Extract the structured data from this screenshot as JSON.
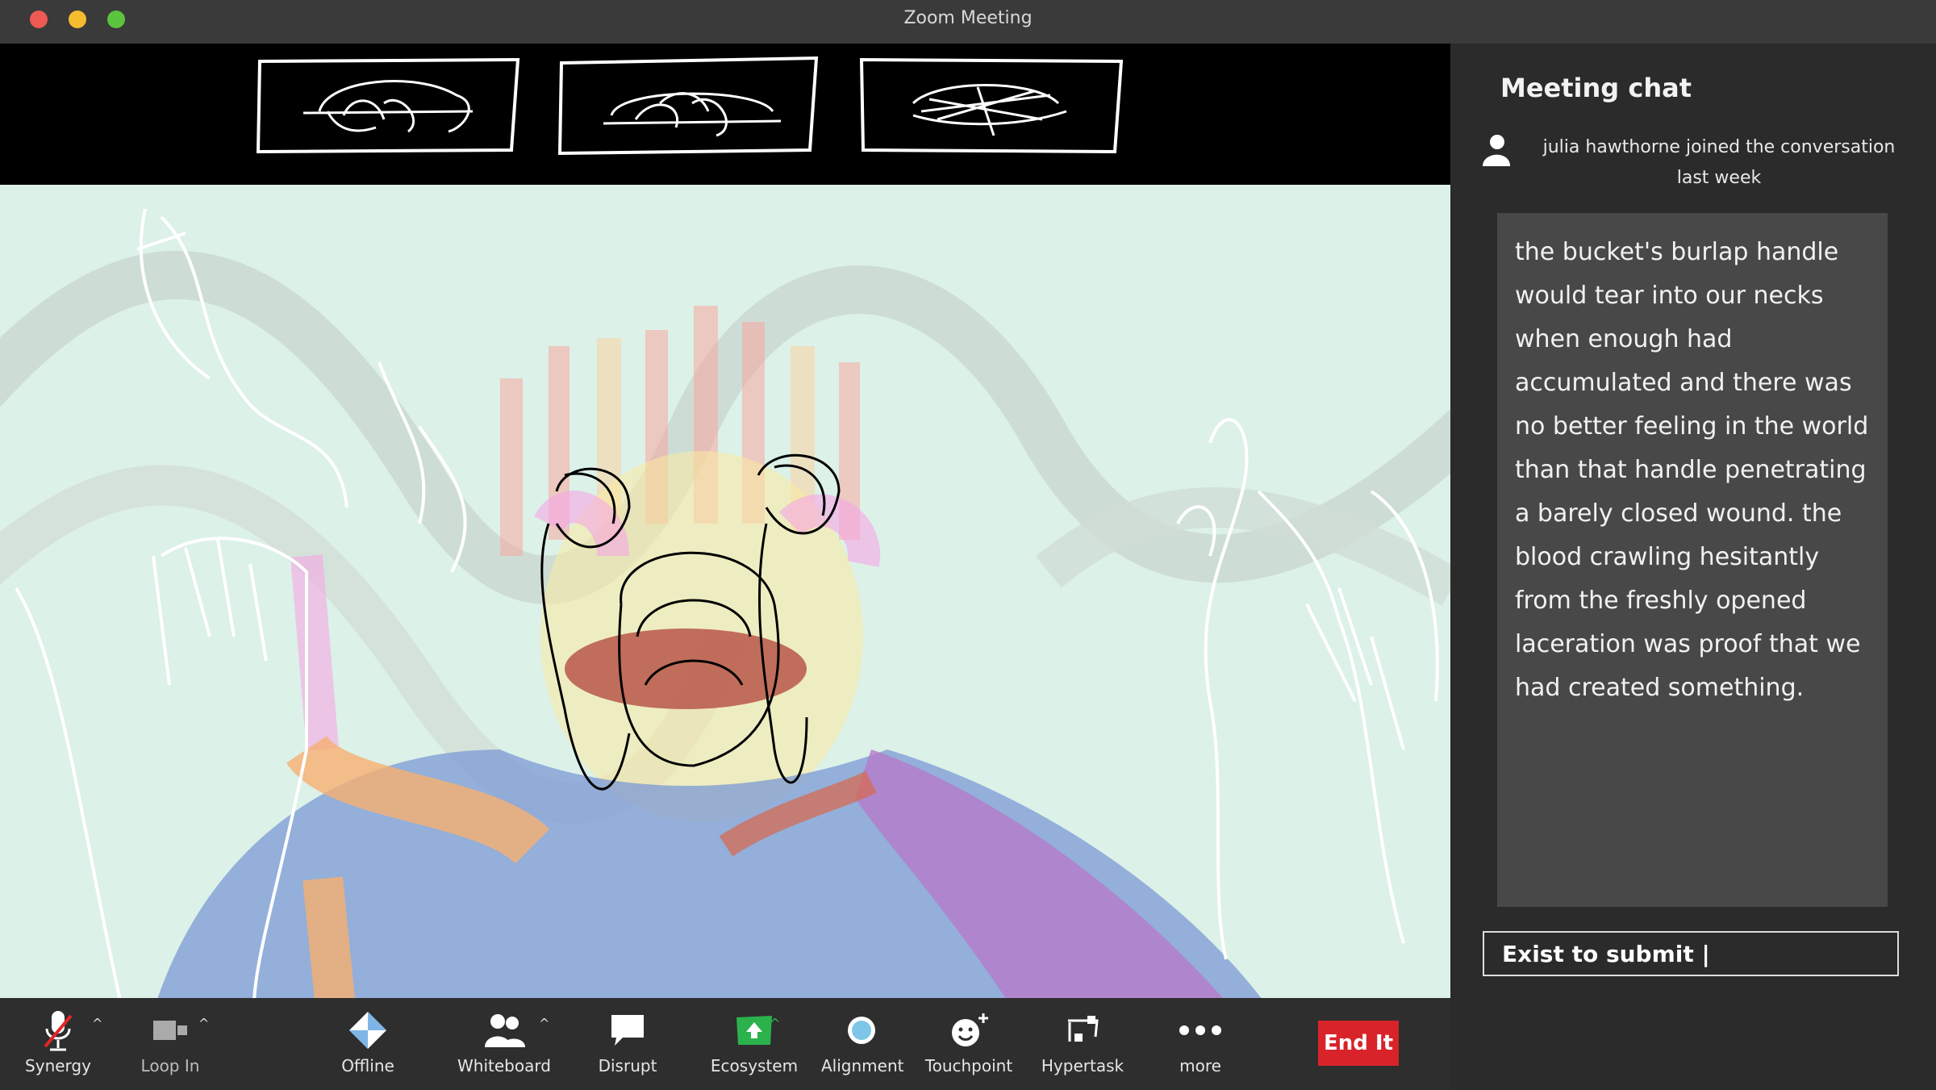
{
  "window": {
    "title": "Zoom Meeting"
  },
  "toolbar": {
    "items": [
      {
        "label": "Synergy",
        "icon": "muted-microphone-icon"
      },
      {
        "label": "Loop In",
        "icon": "video-camera-icon"
      },
      {
        "label": "Offline",
        "icon": "diamond-arrows-icon"
      },
      {
        "label": "Whiteboard",
        "icon": "participants-icon"
      },
      {
        "label": "Disrupt",
        "icon": "speech-bubble-icon"
      },
      {
        "label": "Ecosystem",
        "icon": "share-screen-icon"
      },
      {
        "label": "Alignment",
        "icon": "record-icon"
      },
      {
        "label": "Touchpoint",
        "icon": "reactions-icon"
      },
      {
        "label": "Hypertask",
        "icon": "apps-icon"
      },
      {
        "label": "more",
        "icon": "more-dots-icon"
      }
    ],
    "end_label": "End It"
  },
  "chat": {
    "title": "Meeting chat",
    "join_notice": "julia hawthorne joined the conversation last week",
    "message": "the bucket's burlap handle would tear into our necks when enough had accumulated and there was no better feeling in the world than that handle penetrating a barely closed wound. the blood crawling hesitantly from the freshly opened laceration was proof that we had created something.",
    "input_value": "Exist to submit |"
  },
  "colors": {
    "accent_end": "#d8232a",
    "ecosystem_green": "#2bb24c"
  }
}
